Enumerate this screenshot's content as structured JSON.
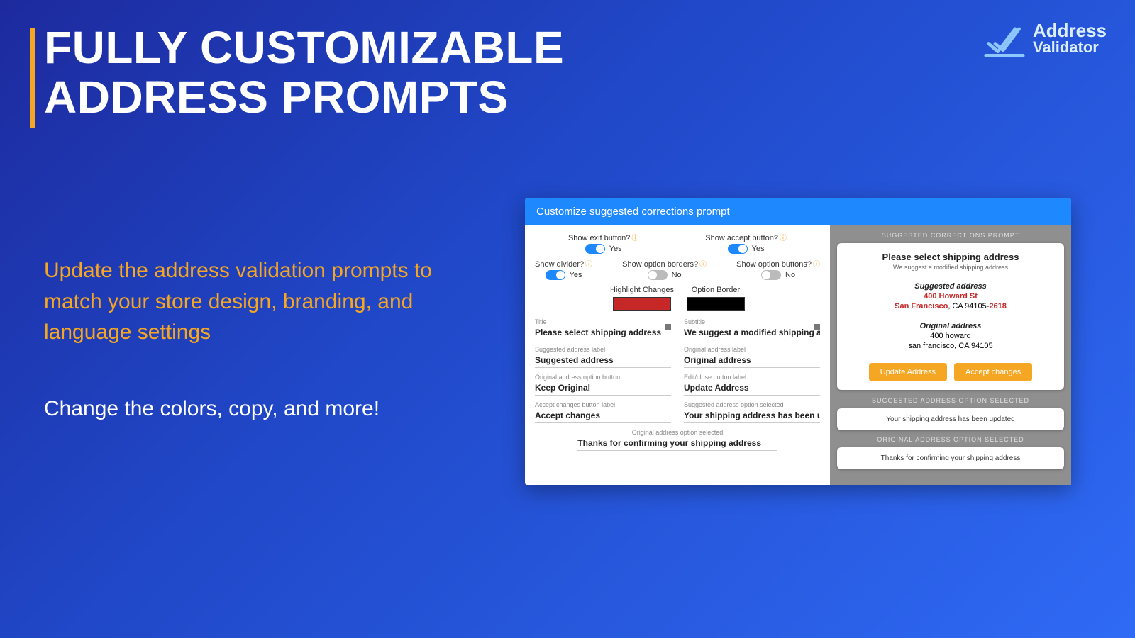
{
  "hero": {
    "title_line1": "FULLY CUSTOMIZABLE",
    "title_line2": "ADDRESS PROMPTS",
    "subhead": "Update the address validation prompts to match your store design, branding, and language settings",
    "subhead2": "Change the colors, copy, and more!"
  },
  "brand": {
    "line1": "Address",
    "line2": "Validator"
  },
  "panel": {
    "header": "Customize suggested corrections prompt",
    "toggles": {
      "exit": {
        "label": "Show exit button?",
        "value": "Yes",
        "on": true
      },
      "accept": {
        "label": "Show accept button?",
        "value": "Yes",
        "on": true
      },
      "divider": {
        "label": "Show divider?",
        "value": "Yes",
        "on": true
      },
      "borders": {
        "label": "Show option borders?",
        "value": "No",
        "on": false
      },
      "buttons": {
        "label": "Show option buttons?",
        "value": "No",
        "on": false
      }
    },
    "swatches": {
      "highlight": {
        "label": "Highlight Changes",
        "color": "#c62828"
      },
      "border": {
        "label": "Option Border",
        "color": "#000000"
      }
    },
    "fields": {
      "title": {
        "label": "Title",
        "value": "Please select shipping address"
      },
      "subtitle": {
        "label": "Subtitle",
        "value": "We suggest a modified shipping address"
      },
      "suggested_lbl": {
        "label": "Suggested address label",
        "value": "Suggested address"
      },
      "original_lbl": {
        "label": "Original address label",
        "value": "Original address"
      },
      "original_btn": {
        "label": "Original address option button",
        "value": "Keep Original"
      },
      "edit_btn": {
        "label": "Edit/close button label",
        "value": "Update Address"
      },
      "accept_btn": {
        "label": "Accept changes button label",
        "value": "Accept changes"
      },
      "suggested_sel": {
        "label": "Suggested address option selected",
        "value": "Your shipping address has been updated"
      },
      "original_sel": {
        "label": "Original address option selected",
        "value": "Thanks for confirming your shipping address"
      }
    }
  },
  "preview": {
    "prompt_heading": "SUGGESTED CORRECTIONS PROMPT",
    "card": {
      "title": "Please select shipping address",
      "subtitle": "We suggest a modified shipping address",
      "suggested_label": "Suggested address",
      "suggested_line1": "400 Howard St",
      "suggested_city": "San Francisco",
      "suggested_rest": ", CA 94105-",
      "suggested_zip_hl": "2618",
      "original_label": "Original address",
      "original_line1": "400 howard",
      "original_line2": "san francisco, CA 94105",
      "update_btn": "Update Address",
      "accept_btn": "Accept changes"
    },
    "selected_heading": "SUGGESTED ADDRESS OPTION SELECTED",
    "selected_msg": "Your shipping address has been updated",
    "original_heading": "ORIGINAL ADDRESS OPTION SELECTED",
    "original_msg": "Thanks for confirming your shipping address"
  }
}
